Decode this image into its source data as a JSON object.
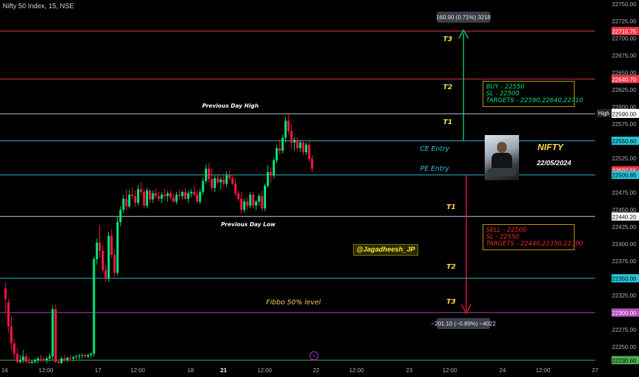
{
  "header": "Nifty 50 Index, 15, NSE",
  "colors": {
    "up": "#00e676",
    "down": "#ff1744",
    "red_line": "#f23645",
    "white_line": "#d1d4dc",
    "cyan_line": "#26c6da",
    "purple_line": "#b04dbb",
    "green_line": "#4caf50",
    "gold": "#ffd54f",
    "cyan_text": "#26c6da",
    "axis_text": "#b2b5be",
    "measure_box": "#3b3f4a"
  },
  "price_axis": {
    "ticks": [
      "22750.00",
      "22725.00",
      "22700.00",
      "22675.00",
      "22650.00",
      "22625.00",
      "22600.00",
      "22575.00",
      "22550.00",
      "22525.00",
      "22500.00",
      "22475.00",
      "22450.00",
      "22425.00",
      "22400.00",
      "22375.00",
      "22350.00",
      "22325.00",
      "22300.00",
      "22275.00",
      "22250.00"
    ]
  },
  "time_axis": {
    "labels": [
      "16",
      "12:00",
      "17",
      "12:00",
      "18",
      "21",
      "12:00",
      "22",
      "12:00",
      "23",
      "12:00",
      "24",
      "12:00",
      "27"
    ],
    "bold": [
      "21"
    ]
  },
  "levels": [
    {
      "price": 22710.75,
      "label": "22710.75",
      "style": "red"
    },
    {
      "price": 22640.7,
      "label": "22640.70",
      "style": "red"
    },
    {
      "price": 22591.1,
      "label": "22591.10",
      "style": "high_tag",
      "tag": "High"
    },
    {
      "price": 22590.0,
      "label": "22590.00",
      "style": "white"
    },
    {
      "price": 22550.6,
      "label": "22550.60",
      "style": "cyan"
    },
    {
      "price": 22507.55,
      "label": "22507.55",
      "style": "red_current"
    },
    {
      "price": 22500.85,
      "label": "22500.85",
      "style": "cyan"
    },
    {
      "price": 22440.2,
      "label": "22440.20",
      "style": "white"
    },
    {
      "price": 22350.0,
      "label": "22350.00",
      "style": "cyan"
    },
    {
      "price": 22300.0,
      "label": "22300.00",
      "style": "purple"
    },
    {
      "price": 22230.6,
      "label": "22230.60",
      "style": "green"
    }
  ],
  "line_labels": {
    "prev_high": "Previous Day High",
    "prev_low": "Previous Day Low",
    "ce_entry": "CE Entry",
    "pe_entry": "PE Entry",
    "fibbo": "Fibbo 50% level",
    "t_up": [
      "T3",
      "T2",
      "T1"
    ],
    "t_down": [
      "T1",
      "T2",
      "T3"
    ]
  },
  "measure_up": "160.90 (0.71%) 3218",
  "measure_down": "−201.10 (−0.89%) −4022",
  "buy_box": [
    "BUY - 22550",
    "SL - 22500",
    "TARGETS - 22590,22640,22710"
  ],
  "sell_box": [
    "SELL - 22500",
    "SL - 22550",
    "TARGETS - 22440,22350,22300"
  ],
  "handle": "@Jagadheesh_JP",
  "title_tag": "NIFTY",
  "date_tag": "22/05/2024",
  "chart_data": {
    "type": "candlestick",
    "y_unit": "price",
    "ylim": [
      22225,
      22770
    ],
    "x_sessions": [
      "16",
      "17",
      "18",
      "21",
      "22"
    ],
    "candles": [
      [
        22335,
        22345,
        22300,
        22320
      ],
      [
        22315,
        22320,
        22270,
        22280
      ],
      [
        22280,
        22295,
        22245,
        22255
      ],
      [
        22255,
        22262,
        22232,
        22240
      ],
      [
        22240,
        22248,
        22225,
        22228
      ],
      [
        22228,
        22238,
        22220,
        22230
      ],
      [
        22230,
        22245,
        22222,
        22236
      ],
      [
        22236,
        22240,
        22222,
        22228
      ],
      [
        22228,
        22235,
        22220,
        22225
      ],
      [
        22225,
        22230,
        22222,
        22228
      ],
      [
        22228,
        22233,
        22225,
        22230
      ],
      [
        22230,
        22236,
        22226,
        22233
      ],
      [
        22233,
        22238,
        22228,
        22232
      ],
      [
        22232,
        22235,
        22228,
        22230
      ],
      [
        22230,
        22236,
        22226,
        22233
      ],
      [
        22233,
        22240,
        22229,
        22236
      ],
      [
        22236,
        22310,
        22230,
        22305
      ],
      [
        22305,
        22312,
        22222,
        22228
      ],
      [
        22228,
        22232,
        22222,
        22226
      ],
      [
        22226,
        22236,
        22224,
        22233
      ],
      [
        22233,
        22238,
        22228,
        22231
      ],
      [
        22231,
        22236,
        22228,
        22234
      ],
      [
        22234,
        22238,
        22230,
        22233
      ],
      [
        22233,
        22237,
        22229,
        22235
      ],
      [
        22235,
        22239,
        22232,
        22236
      ],
      [
        22236,
        22240,
        22232,
        22237
      ],
      [
        22237,
        22241,
        22233,
        22238
      ],
      [
        22238,
        22240,
        22234,
        22236
      ],
      [
        22236,
        22240,
        22233,
        22238
      ],
      [
        22238,
        22242,
        22234,
        22240
      ],
      [
        22240,
        22382,
        22236,
        22378
      ],
      [
        22378,
        22408,
        22370,
        22402
      ],
      [
        22402,
        22428,
        22380,
        22390
      ],
      [
        22390,
        22398,
        22358,
        22362
      ],
      [
        22362,
        22370,
        22345,
        22350
      ],
      [
        22350,
        22418,
        22345,
        22412
      ],
      [
        22412,
        22422,
        22380,
        22384
      ],
      [
        22384,
        22392,
        22352,
        22358
      ],
      [
        22358,
        22440,
        22354,
        22432
      ],
      [
        22432,
        22455,
        22426,
        22450
      ],
      [
        22450,
        22472,
        22445,
        22466
      ],
      [
        22466,
        22480,
        22450,
        22455
      ],
      [
        22455,
        22478,
        22452,
        22472
      ],
      [
        22472,
        22482,
        22466,
        22470
      ],
      [
        22470,
        22478,
        22455,
        22460
      ],
      [
        22460,
        22486,
        22456,
        22480
      ],
      [
        22480,
        22490,
        22470,
        22476
      ],
      [
        22476,
        22480,
        22452,
        22456
      ],
      [
        22456,
        22482,
        22452,
        22478
      ],
      [
        22478,
        22480,
        22460,
        22465
      ],
      [
        22465,
        22478,
        22460,
        22474
      ],
      [
        22474,
        22481,
        22466,
        22470
      ],
      [
        22470,
        22476,
        22462,
        22466
      ],
      [
        22466,
        22476,
        22460,
        22472
      ],
      [
        22472,
        22480,
        22465,
        22470
      ],
      [
        22470,
        22477,
        22462,
        22474
      ],
      [
        22474,
        22478,
        22465,
        22468
      ],
      [
        22468,
        22474,
        22460,
        22462
      ],
      [
        22462,
        22476,
        22458,
        22472
      ],
      [
        22472,
        22480,
        22466,
        22470
      ],
      [
        22470,
        22478,
        22465,
        22476
      ],
      [
        22476,
        22482,
        22464,
        22466
      ],
      [
        22466,
        22478,
        22460,
        22474
      ],
      [
        22474,
        22480,
        22468,
        22476
      ],
      [
        22476,
        22484,
        22470,
        22472
      ],
      [
        22472,
        22478,
        22460,
        22462
      ],
      [
        22462,
        22480,
        22458,
        22476
      ],
      [
        22476,
        22496,
        22472,
        22492
      ],
      [
        22492,
        22516,
        22488,
        22510
      ],
      [
        22510,
        22518,
        22490,
        22495
      ],
      [
        22495,
        22510,
        22478,
        22482
      ],
      [
        22482,
        22500,
        22476,
        22496
      ],
      [
        22496,
        22502,
        22488,
        22490
      ],
      [
        22490,
        22498,
        22480,
        22494
      ],
      [
        22494,
        22500,
        22484,
        22488
      ],
      [
        22488,
        22506,
        22484,
        22500
      ],
      [
        22500,
        22508,
        22492,
        22496
      ],
      [
        22496,
        22500,
        22486,
        22488
      ],
      [
        22488,
        22496,
        22470,
        22474
      ],
      [
        22474,
        22478,
        22462,
        22466
      ],
      [
        22466,
        22476,
        22444,
        22450
      ],
      [
        22450,
        22466,
        22446,
        22462
      ],
      [
        22462,
        22468,
        22450,
        22456
      ],
      [
        22456,
        22476,
        22452,
        22472
      ],
      [
        22472,
        22476,
        22452,
        22456
      ],
      [
        22456,
        22464,
        22450,
        22462
      ],
      [
        22462,
        22474,
        22456,
        22470
      ],
      [
        22470,
        22478,
        22448,
        22452
      ],
      [
        22452,
        22488,
        22448,
        22485
      ],
      [
        22485,
        22515,
        22482,
        22505
      ],
      [
        22505,
        22512,
        22490,
        22500
      ],
      [
        22500,
        22526,
        22496,
        22522
      ],
      [
        22522,
        22545,
        22518,
        22540
      ],
      [
        22540,
        22552,
        22530,
        22536
      ],
      [
        22536,
        22560,
        22532,
        22555
      ],
      [
        22555,
        22585,
        22548,
        22580
      ],
      [
        22580,
        22591,
        22560,
        22565
      ],
      [
        22565,
        22575,
        22540,
        22548
      ],
      [
        22548,
        22556,
        22536,
        22552
      ],
      [
        22552,
        22556,
        22536,
        22540
      ],
      [
        22540,
        22552,
        22534,
        22548
      ],
      [
        22548,
        22550,
        22530,
        22534
      ],
      [
        22534,
        22548,
        22530,
        22545
      ],
      [
        22545,
        22552,
        22520,
        22524
      ],
      [
        22524,
        22530,
        22505,
        22510
      ]
    ]
  }
}
